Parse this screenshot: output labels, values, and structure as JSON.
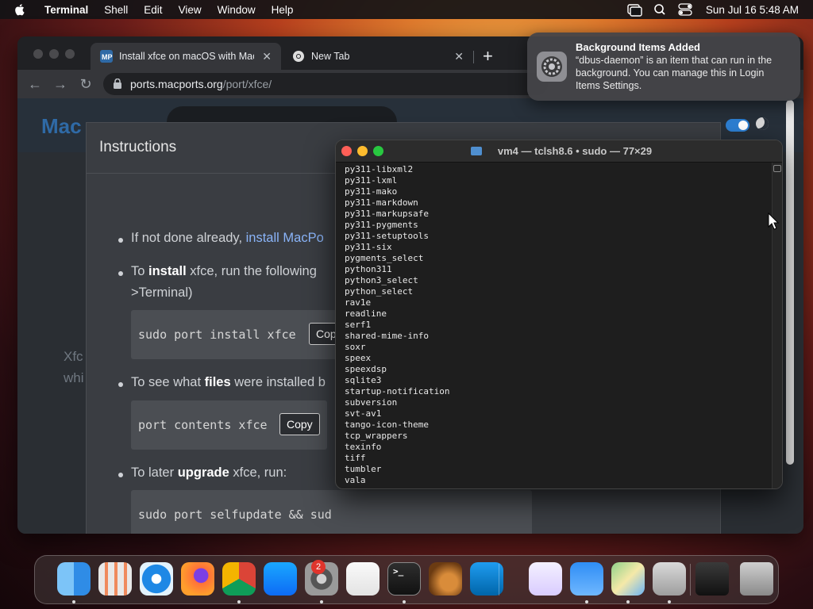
{
  "menubar": {
    "app_name": "Terminal",
    "items": [
      "Shell",
      "Edit",
      "View",
      "Window",
      "Help"
    ],
    "clock": "Sun Jul 16  5:48 AM"
  },
  "browser": {
    "tabs": [
      {
        "title": "Install xfce on macOS with Mac",
        "favicon": "macports-icon"
      },
      {
        "title": "New Tab",
        "favicon": "chrome-icon"
      }
    ],
    "url_host": "ports.macports.org",
    "url_path": "/port/xfce/",
    "page": {
      "background_text": [
        "Xfc",
        "whi"
      ],
      "modal": {
        "title": "Instructions",
        "step1": {
          "prefix": "If not done already, ",
          "link": "install MacPo"
        },
        "step2": {
          "pre": "To ",
          "bold": "install",
          "post": " xfce, run the following",
          "line2": ">Terminal)"
        },
        "code1": "sudo port install xfce",
        "copy1": "Cop",
        "step3": {
          "pre": "To see what ",
          "bold": "files",
          "post": " were installed b"
        },
        "code2": "port contents xfce",
        "copy2": "Copy",
        "step4": {
          "pre": "To later ",
          "bold": "upgrade",
          "post": " xfce, run:"
        },
        "code3": "sudo port selfupdate && sud"
      }
    }
  },
  "notification": {
    "title": "Background Items Added",
    "body": "“dbus-daemon” is an item that can run in the background. You can manage this in Login Items Settings."
  },
  "terminal": {
    "title": "vm4 — tclsh8.6 • sudo — 77×29",
    "lines": [
      "py311-libxml2",
      "py311-lxml",
      "py311-mako",
      "py311-markdown",
      "py311-markupsafe",
      "py311-pygments",
      "py311-setuptools",
      "py311-six",
      "pygments_select",
      "python311",
      "python3_select",
      "python_select",
      "rav1e",
      "readline",
      "serf1",
      "shared-mime-info",
      "soxr",
      "speex",
      "speexdsp",
      "sqlite3",
      "startup-notification",
      "subversion",
      "svt-av1",
      "tango-icon-theme",
      "tcp_wrappers",
      "texinfo",
      "tiff",
      "tumbler",
      "vala"
    ]
  },
  "dock": {
    "badge_count": "2",
    "apps": [
      "finder",
      "launchpad",
      "safari",
      "firefox",
      "chrome",
      "app-store",
      "system-settings",
      "textedit",
      "terminal",
      "instruments",
      "vscode",
      "visual-studio",
      "weather",
      "maps",
      "installer",
      "screen-share",
      "trash"
    ]
  },
  "colors": {
    "accent": "#2d7fd3",
    "link": "#8ab4f8",
    "close": "#ff5f57",
    "minimize": "#febc2e",
    "zoom": "#28c840"
  }
}
